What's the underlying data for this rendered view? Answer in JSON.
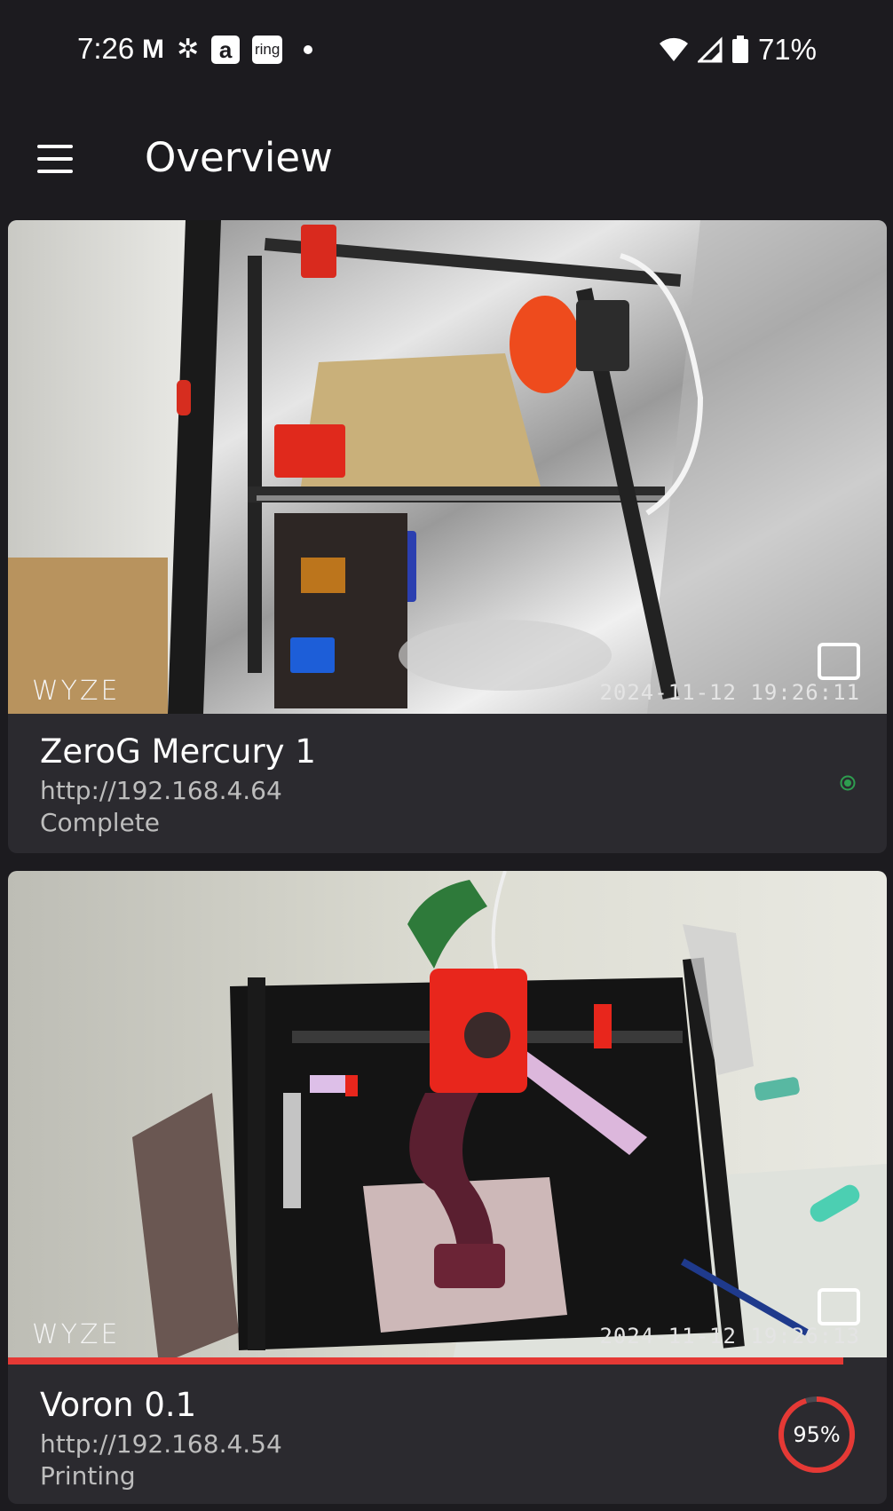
{
  "status_bar": {
    "time": "7:26",
    "notification_icons": [
      "gmail-icon",
      "fan-icon",
      "amazon-icon",
      "ring-icon",
      "dot-icon"
    ],
    "amazon_glyph": "a",
    "ring_glyph": "ring",
    "battery_percent": "71%"
  },
  "app_bar": {
    "title": "Overview"
  },
  "printers": [
    {
      "name": "ZeroG Mercury 1",
      "url": "http://192.168.4.64",
      "status": "Complete",
      "online": true,
      "camera": {
        "brand": "WYZE",
        "timestamp": "2024-11-12  19:26:11"
      }
    },
    {
      "name": "Voron 0.1",
      "url": "http://192.168.4.54",
      "status": "Printing",
      "progress": 0.95,
      "progress_label": "95%",
      "camera": {
        "brand": "WYZE",
        "timestamp": "2024-11-12  19:26:13"
      }
    }
  ],
  "colors": {
    "background": "#1c1b1f",
    "card": "#2b2a2f",
    "progress": "#e53935",
    "online": "#2e9d4f"
  }
}
